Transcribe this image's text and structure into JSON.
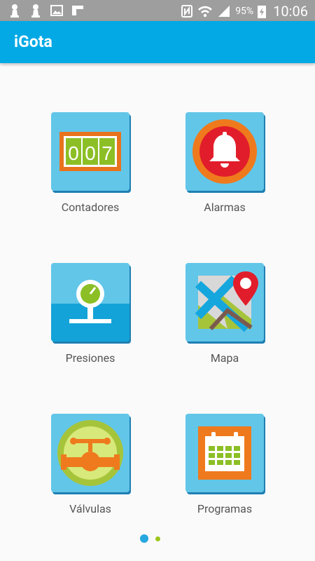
{
  "status_bar": {
    "left_icons": [
      "notification-pawn-icon",
      "notification-pawn-icon",
      "image-icon",
      "flipboard-icon"
    ],
    "battery": "95%",
    "time": "10:06"
  },
  "app": {
    "title": "iGota"
  },
  "menu": [
    {
      "label": "Contadores",
      "icon": "counter-icon"
    },
    {
      "label": "Alarmas",
      "icon": "alarm-bell-icon"
    },
    {
      "label": "Presiones",
      "icon": "pressure-gauge-icon"
    },
    {
      "label": "Mapa",
      "icon": "map-pin-icon"
    },
    {
      "label": "Válvulas",
      "icon": "valve-icon"
    },
    {
      "label": "Programas",
      "icon": "calendar-icon"
    }
  ],
  "counter_digits": "007",
  "pager": {
    "pages": 2,
    "current": 1
  }
}
